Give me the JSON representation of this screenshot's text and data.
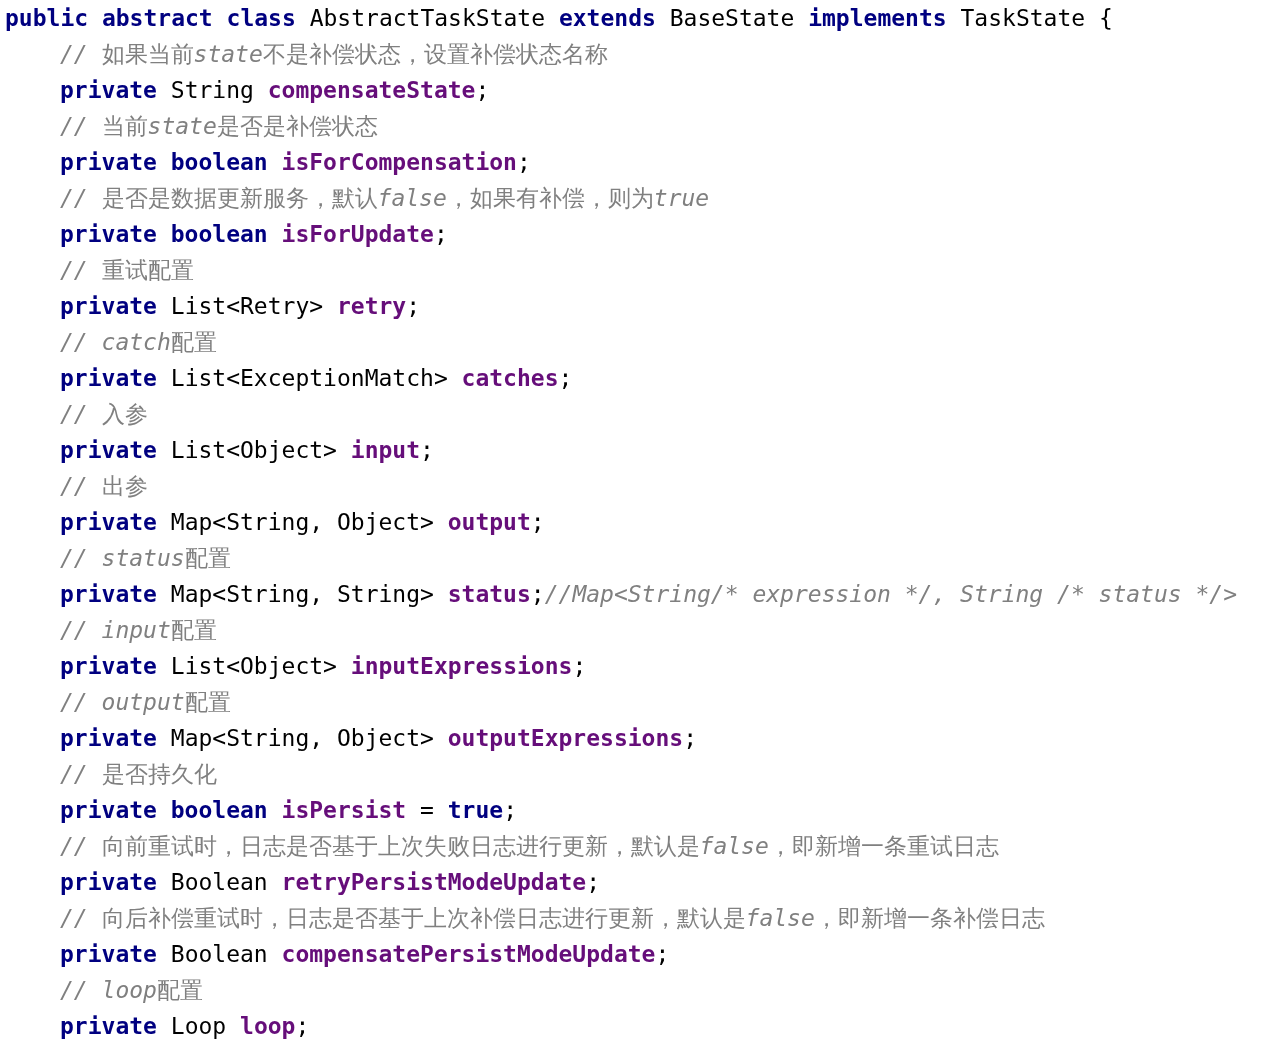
{
  "editor": {
    "declaration": [
      {
        "kind": "keyword",
        "text": "public abstract class"
      },
      {
        "kind": "plain",
        "text": " AbstractTaskState "
      },
      {
        "kind": "keyword",
        "text": "extends"
      },
      {
        "kind": "plain",
        "text": " BaseState "
      },
      {
        "kind": "keyword",
        "text": "implements"
      },
      {
        "kind": "plain",
        "text": " TaskState {"
      }
    ],
    "members": [
      [
        {
          "kind": "comment",
          "text": "// "
        },
        {
          "kind": "comment_text",
          "text": "如果当前"
        },
        {
          "kind": "comment",
          "text": "state"
        },
        {
          "kind": "comment_text",
          "text": "不是补偿状态，设置补偿状态名称"
        }
      ],
      [
        {
          "kind": "keyword",
          "text": "private"
        },
        {
          "kind": "plain",
          "text": " String "
        },
        {
          "kind": "field",
          "text": "compensateState"
        },
        {
          "kind": "plain",
          "text": ";"
        }
      ],
      [
        {
          "kind": "comment",
          "text": "// "
        },
        {
          "kind": "comment_text",
          "text": "当前"
        },
        {
          "kind": "comment",
          "text": "state"
        },
        {
          "kind": "comment_text",
          "text": "是否是补偿状态"
        }
      ],
      [
        {
          "kind": "keyword",
          "text": "private boolean "
        },
        {
          "kind": "field",
          "text": "isForCompensation"
        },
        {
          "kind": "plain",
          "text": ";"
        }
      ],
      [
        {
          "kind": "comment",
          "text": "// "
        },
        {
          "kind": "comment_text",
          "text": "是否是数据更新服务，默认"
        },
        {
          "kind": "comment",
          "text": "false"
        },
        {
          "kind": "comment_text",
          "text": "，如果有补偿，则为"
        },
        {
          "kind": "comment",
          "text": "true"
        }
      ],
      [
        {
          "kind": "keyword",
          "text": "private boolean "
        },
        {
          "kind": "field",
          "text": "isForUpdate"
        },
        {
          "kind": "plain",
          "text": ";"
        }
      ],
      [
        {
          "kind": "comment",
          "text": "// "
        },
        {
          "kind": "comment_text",
          "text": "重试配置"
        }
      ],
      [
        {
          "kind": "keyword",
          "text": "private"
        },
        {
          "kind": "plain",
          "text": " List<Retry> "
        },
        {
          "kind": "field",
          "text": "retry"
        },
        {
          "kind": "plain",
          "text": ";"
        }
      ],
      [
        {
          "kind": "comment",
          "text": "// catch"
        },
        {
          "kind": "comment_text",
          "text": "配置"
        }
      ],
      [
        {
          "kind": "keyword",
          "text": "private"
        },
        {
          "kind": "plain",
          "text": " List<ExceptionMatch> "
        },
        {
          "kind": "field",
          "text": "catches"
        },
        {
          "kind": "plain",
          "text": ";"
        }
      ],
      [
        {
          "kind": "comment",
          "text": "// "
        },
        {
          "kind": "comment_text",
          "text": "入参"
        }
      ],
      [
        {
          "kind": "keyword",
          "text": "private"
        },
        {
          "kind": "plain",
          "text": " List<Object> "
        },
        {
          "kind": "field",
          "text": "input"
        },
        {
          "kind": "plain",
          "text": ";"
        }
      ],
      [
        {
          "kind": "comment",
          "text": "// "
        },
        {
          "kind": "comment_text",
          "text": "出参"
        }
      ],
      [
        {
          "kind": "keyword",
          "text": "private"
        },
        {
          "kind": "plain",
          "text": " Map<String, Object> "
        },
        {
          "kind": "field",
          "text": "output"
        },
        {
          "kind": "plain",
          "text": ";"
        }
      ],
      [
        {
          "kind": "comment",
          "text": "// status"
        },
        {
          "kind": "comment_text",
          "text": "配置"
        }
      ],
      [
        {
          "kind": "keyword",
          "text": "private"
        },
        {
          "kind": "plain",
          "text": " Map<String, String> "
        },
        {
          "kind": "field",
          "text": "status"
        },
        {
          "kind": "plain",
          "text": ";"
        },
        {
          "kind": "comment",
          "text": "//Map<String/* expression */, String /* status */>"
        }
      ],
      [
        {
          "kind": "comment",
          "text": "// input"
        },
        {
          "kind": "comment_text",
          "text": "配置"
        }
      ],
      [
        {
          "kind": "keyword",
          "text": "private"
        },
        {
          "kind": "plain",
          "text": " List<Object> "
        },
        {
          "kind": "field",
          "text": "inputExpressions"
        },
        {
          "kind": "plain",
          "text": ";"
        }
      ],
      [
        {
          "kind": "comment",
          "text": "// output"
        },
        {
          "kind": "comment_text",
          "text": "配置"
        }
      ],
      [
        {
          "kind": "keyword",
          "text": "private"
        },
        {
          "kind": "plain",
          "text": " Map<String, Object> "
        },
        {
          "kind": "field",
          "text": "outputExpressions"
        },
        {
          "kind": "plain",
          "text": ";"
        }
      ],
      [
        {
          "kind": "comment",
          "text": "// "
        },
        {
          "kind": "comment_text",
          "text": "是否持久化"
        }
      ],
      [
        {
          "kind": "keyword",
          "text": "private boolean "
        },
        {
          "kind": "field",
          "text": "isPersist"
        },
        {
          "kind": "plain",
          "text": " = "
        },
        {
          "kind": "keyword",
          "text": "true"
        },
        {
          "kind": "plain",
          "text": ";"
        }
      ],
      [
        {
          "kind": "comment",
          "text": "// "
        },
        {
          "kind": "comment_text",
          "text": "向前重试时，日志是否基于上次失败日志进行更新，默认是"
        },
        {
          "kind": "comment",
          "text": "false"
        },
        {
          "kind": "comment_text",
          "text": "，即新增一条重试日志"
        }
      ],
      [
        {
          "kind": "keyword",
          "text": "private"
        },
        {
          "kind": "plain",
          "text": " Boolean "
        },
        {
          "kind": "field",
          "text": "retryPersistModeUpdate"
        },
        {
          "kind": "plain",
          "text": ";"
        }
      ],
      [
        {
          "kind": "comment",
          "text": "// "
        },
        {
          "kind": "comment_text",
          "text": "向后补偿重试时，日志是否基于上次补偿日志进行更新，默认是"
        },
        {
          "kind": "comment",
          "text": "false"
        },
        {
          "kind": "comment_text",
          "text": "，即新增一条补偿日志"
        }
      ],
      [
        {
          "kind": "keyword",
          "text": "private"
        },
        {
          "kind": "plain",
          "text": " Boolean "
        },
        {
          "kind": "field",
          "text": "compensatePersistModeUpdate"
        },
        {
          "kind": "plain",
          "text": ";"
        }
      ],
      [
        {
          "kind": "comment",
          "text": "// loop"
        },
        {
          "kind": "comment_text",
          "text": "配置"
        }
      ],
      [
        {
          "kind": "keyword",
          "text": "private"
        },
        {
          "kind": "plain",
          "text": " Loop "
        },
        {
          "kind": "field",
          "text": "loop"
        },
        {
          "kind": "plain",
          "text": ";"
        }
      ]
    ]
  }
}
